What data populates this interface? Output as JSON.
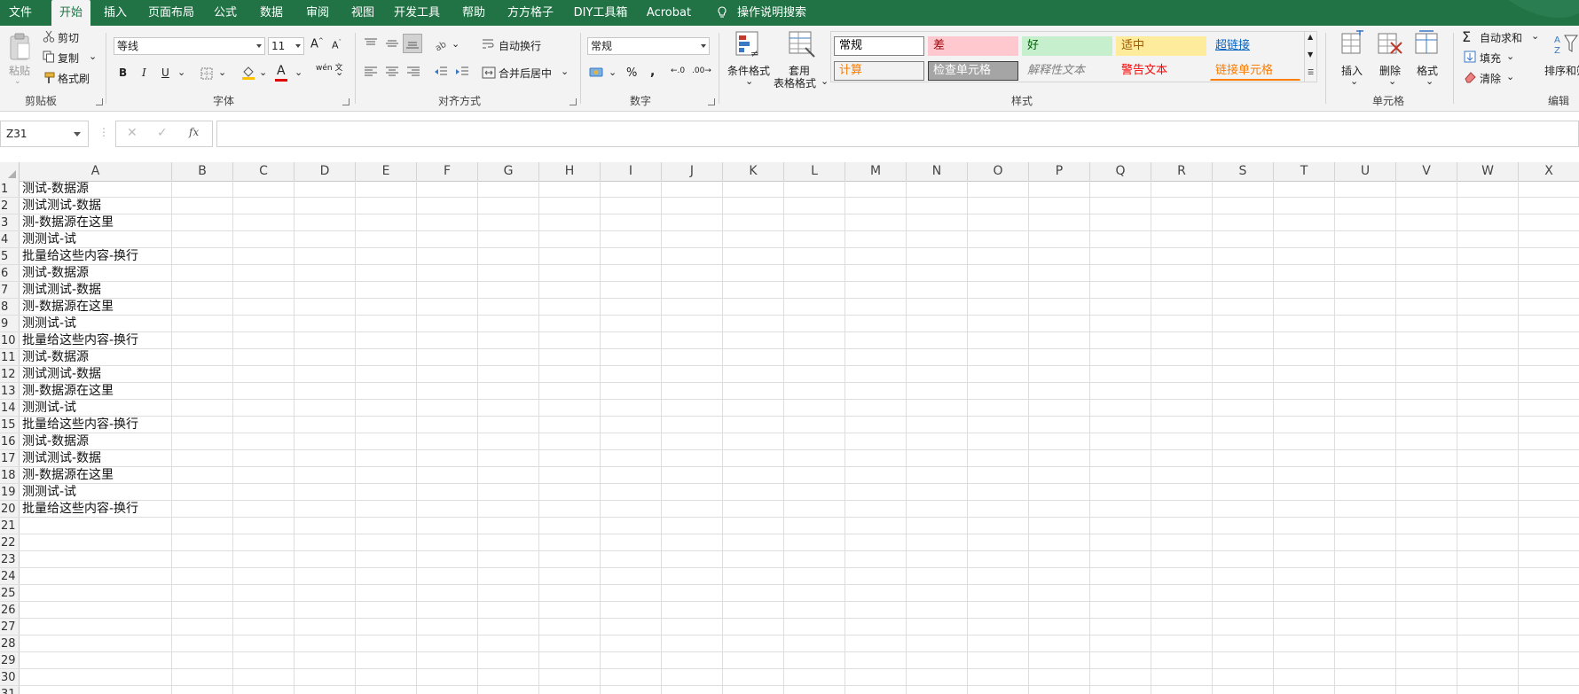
{
  "menu": {
    "file": "文件",
    "tabs": [
      "开始",
      "插入",
      "页面布局",
      "公式",
      "数据",
      "审阅",
      "视图",
      "开发工具",
      "帮助",
      "方方格子",
      "DIY工具箱",
      "Acrobat"
    ],
    "active_tab": "开始",
    "tell_me": "操作说明搜索",
    "accent": "#217346"
  },
  "ribbon": {
    "clipboard": {
      "paste": "粘贴",
      "cut": "剪切",
      "copy": "复制",
      "format_painter": "格式刷",
      "label": "剪贴板"
    },
    "font": {
      "font_name": "等线",
      "font_size": "11",
      "label": "字体",
      "bold": "B",
      "italic": "I",
      "underline": "U",
      "font_color_glyph": "A",
      "phonetic": "wén 文"
    },
    "alignment": {
      "wrap_text": "自动换行",
      "merge_center": "合并后居中",
      "label": "对齐方式"
    },
    "number": {
      "format": "常规",
      "percent": "%",
      "comma": ",",
      "label": "数字"
    },
    "styles": {
      "conditional": "条件格式",
      "table_format_1": "套用",
      "table_format_2": "表格格式",
      "label": "样式",
      "gallery": [
        {
          "text": "常规",
          "bg": "#ffffff",
          "fg": "#000000",
          "border": "#7f7f7f"
        },
        {
          "text": "差",
          "bg": "#ffc7ce",
          "fg": "#9c0006",
          "border": "#ffc7ce"
        },
        {
          "text": "好",
          "bg": "#c6efce",
          "fg": "#006100",
          "border": "#c6efce"
        },
        {
          "text": "适中",
          "bg": "#ffeb9c",
          "fg": "#9c5700",
          "border": "#ffeb9c"
        },
        {
          "text": "超链接",
          "bg": "#f3f3f3",
          "fg": "#0563c1",
          "border": "#f3f3f3"
        },
        {
          "text": "计算",
          "bg": "#f2f2f2",
          "fg": "#fa7d00",
          "border": "#7f7f7f"
        },
        {
          "text": "检查单元格",
          "bg": "#a5a5a5",
          "fg": "#ffffff",
          "border": "#3f3f3f"
        },
        {
          "text": "解释性文本",
          "bg": "#f3f3f3",
          "fg": "#7f7f7f",
          "border": "#f3f3f3"
        },
        {
          "text": "警告文本",
          "bg": "#f3f3f3",
          "fg": "#ff0000",
          "border": "#f3f3f3"
        },
        {
          "text": "链接单元格",
          "bg": "#f3f3f3",
          "fg": "#fa7d00",
          "border": "#f3f3f3"
        }
      ]
    },
    "cells": {
      "insert": "插入",
      "delete": "删除",
      "format": "格式",
      "label": "单元格"
    },
    "editing": {
      "autosum": "自动求和",
      "fill": "填充",
      "clear": "清除",
      "sort_filter": "排序和筛",
      "label": "编辑"
    }
  },
  "formula_bar": {
    "name_box": "Z31",
    "fx": "fx",
    "value": ""
  },
  "sheet": {
    "columns": [
      "A",
      "B",
      "C",
      "D",
      "E",
      "F",
      "G",
      "H",
      "I",
      "J",
      "K",
      "L",
      "M",
      "N",
      "O",
      "P",
      "Q",
      "R",
      "S",
      "T",
      "U",
      "V",
      "W",
      "X"
    ],
    "rows": [
      "1",
      "2",
      "3",
      "4",
      "5",
      "6",
      "7",
      "8",
      "9",
      "10",
      "11",
      "12",
      "13",
      "14",
      "15",
      "16",
      "17",
      "18",
      "19",
      "20",
      "21",
      "22",
      "23",
      "24",
      "25",
      "26",
      "27",
      "28",
      "29",
      "30",
      "31"
    ],
    "column_a_values": [
      "测试-数据源",
      "测试测试-数据",
      "测-数据源在这里",
      "测测试-试",
      "批量给这些内容-换行",
      "测试-数据源",
      "测试测试-数据",
      "测-数据源在这里",
      "测测试-试",
      "批量给这些内容-换行",
      "测试-数据源",
      "测试测试-数据",
      "测-数据源在这里",
      "测测试-试",
      "批量给这些内容-换行",
      "测试-数据源",
      "测试测试-数据",
      "测-数据源在这里",
      "测测试-试",
      "批量给这些内容-换行"
    ]
  }
}
